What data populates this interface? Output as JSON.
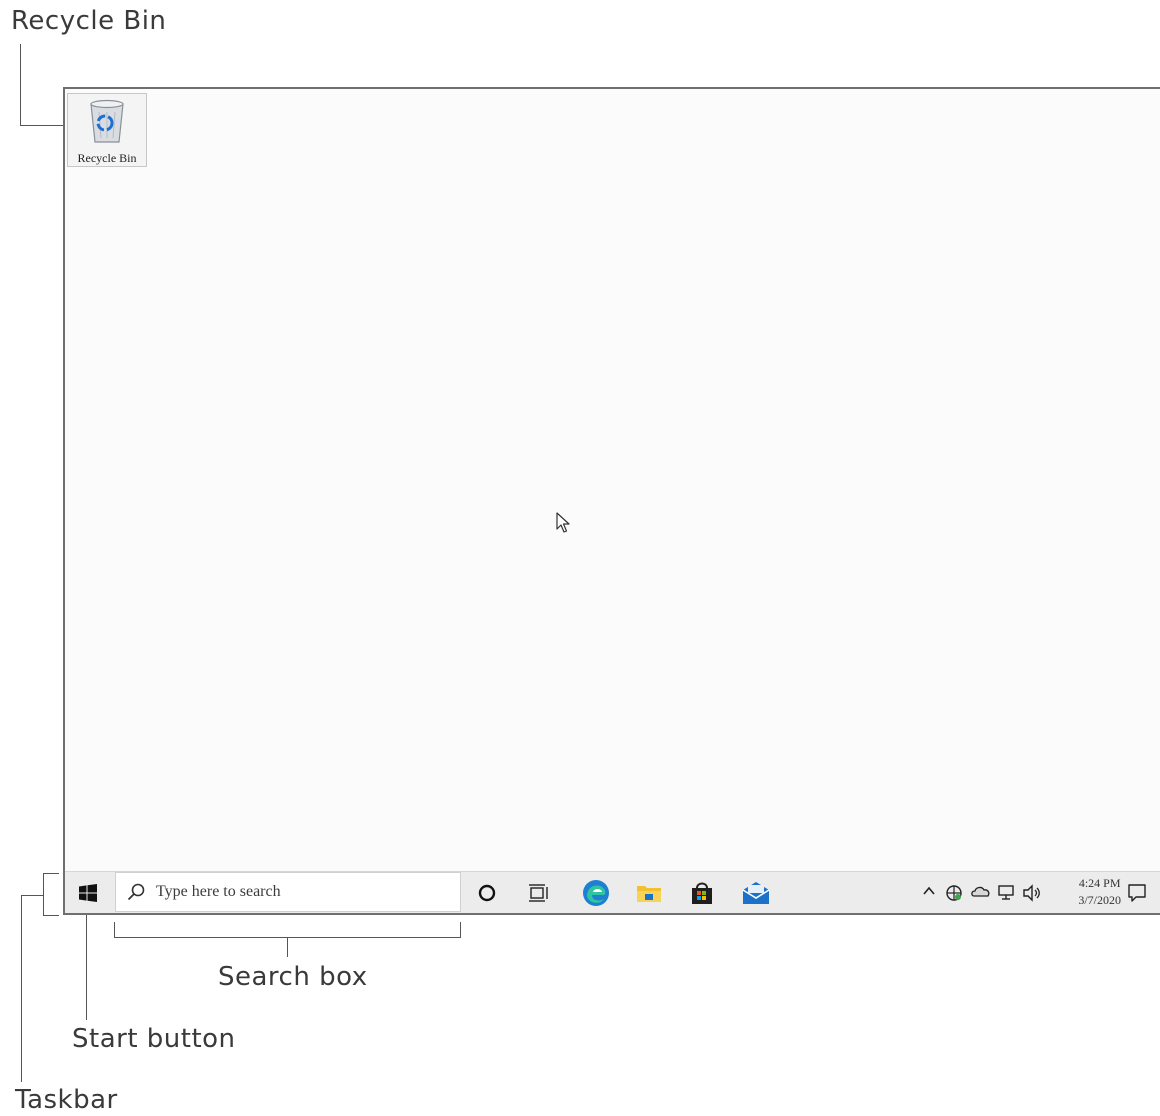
{
  "callouts": {
    "recycle_bin": "Recycle Bin",
    "search_box": "Search box",
    "start_button": "Start button",
    "taskbar": "Taskbar"
  },
  "desktop": {
    "icons": [
      {
        "label": "Recycle Bin",
        "icon": "recycle-bin-icon"
      }
    ]
  },
  "taskbar": {
    "start_icon": "windows-logo-icon",
    "search": {
      "placeholder": "Type here to search",
      "icon": "search-icon"
    },
    "pinned": [
      {
        "name": "cortana",
        "icon": "cortana-circle-icon"
      },
      {
        "name": "task-view",
        "icon": "task-view-icon"
      },
      {
        "name": "edge",
        "icon": "edge-icon"
      },
      {
        "name": "file-explorer",
        "icon": "folder-icon"
      },
      {
        "name": "store",
        "icon": "store-bag-icon"
      },
      {
        "name": "mail",
        "icon": "mail-icon"
      }
    ],
    "tray": {
      "icons": [
        "chevron-up-icon",
        "defender-icon",
        "onedrive-icon",
        "network-icon",
        "volume-icon"
      ],
      "time": "4:24 PM",
      "date": "3/7/2020",
      "notification_icon": "notification-icon"
    }
  },
  "colors": {
    "edge_blue": "#1e7fd3",
    "folder_yellow": "#f2c031",
    "mail_blue": "#1a73c8",
    "accent_green": "#3fa34d"
  }
}
